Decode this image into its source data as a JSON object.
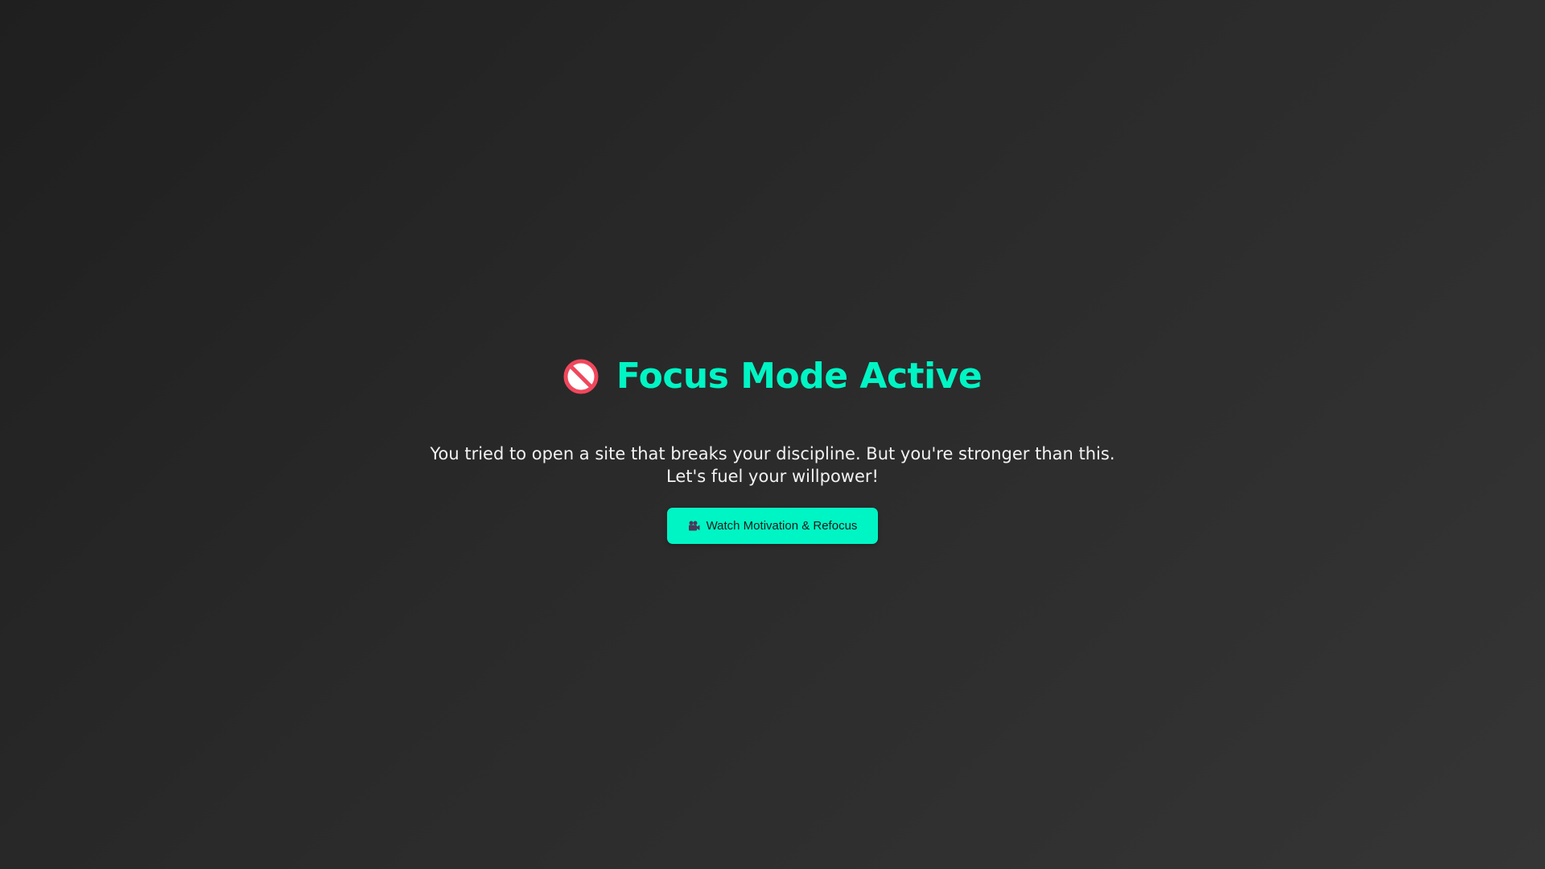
{
  "header": {
    "title_icon": "no-entry-icon",
    "title": "Focus Mode Active"
  },
  "message": {
    "line1": "You tried to open a site that breaks your discipline. But you're stronger than this.",
    "line2": "Let's fuel your willpower!"
  },
  "cta": {
    "icon": "movie-camera-icon",
    "label": "Watch Motivation & Refocus"
  },
  "colors": {
    "accent": "#00f5c4",
    "background_dark": "#1f1f1f",
    "background_light": "#353535",
    "text": "#f2f2f2",
    "icon_red": "#f0475c"
  }
}
